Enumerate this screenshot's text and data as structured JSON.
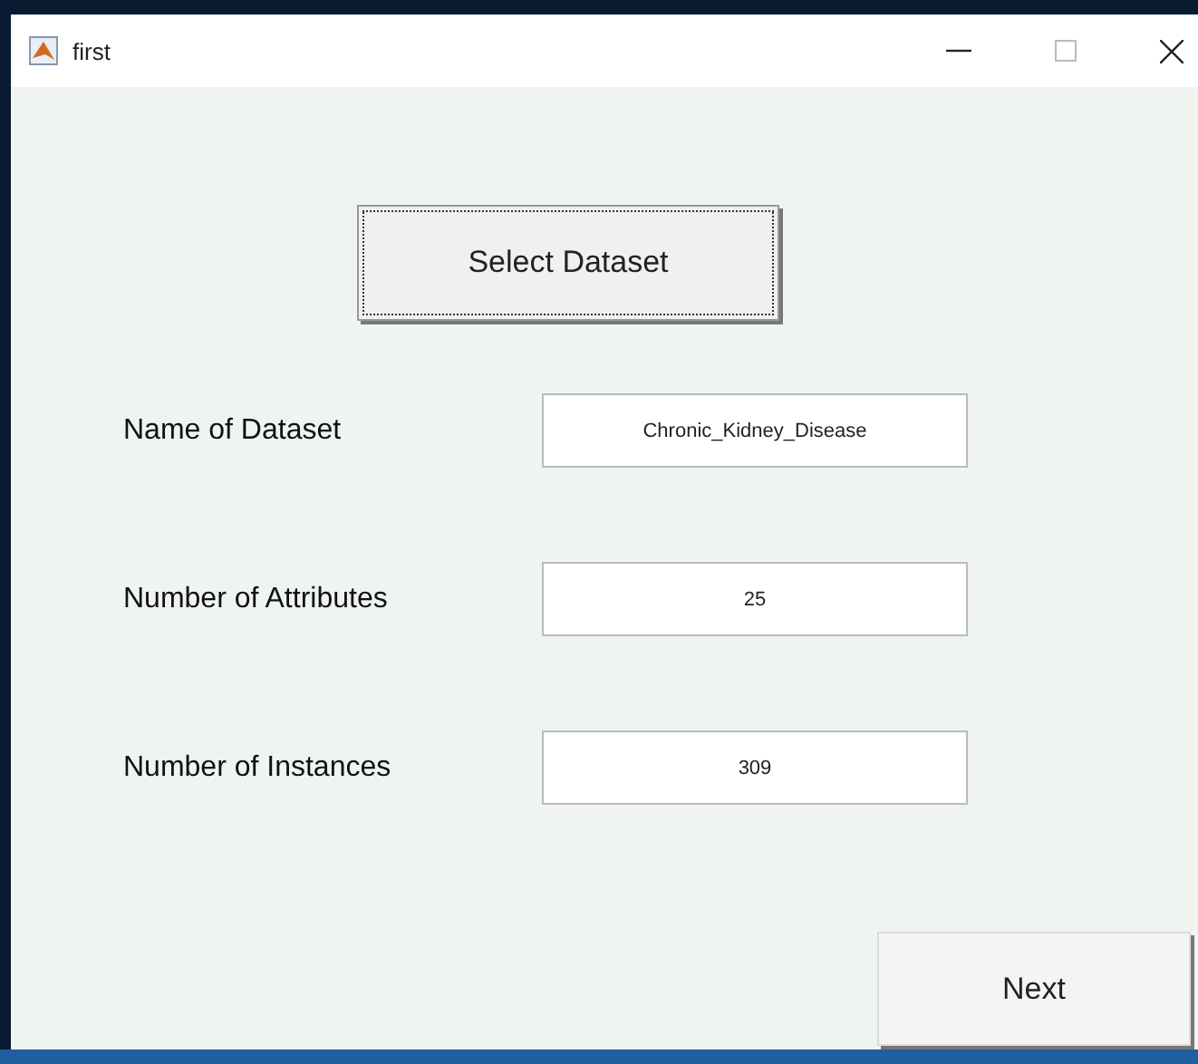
{
  "window": {
    "title": "first"
  },
  "select_button": "Select Dataset",
  "fields": [
    {
      "label": "Name of Dataset",
      "value": "Chronic_Kidney_Disease"
    },
    {
      "label": "Number of Attributes",
      "value": "25"
    },
    {
      "label": "Number of Instances",
      "value": "309"
    }
  ],
  "next_button": "Next"
}
